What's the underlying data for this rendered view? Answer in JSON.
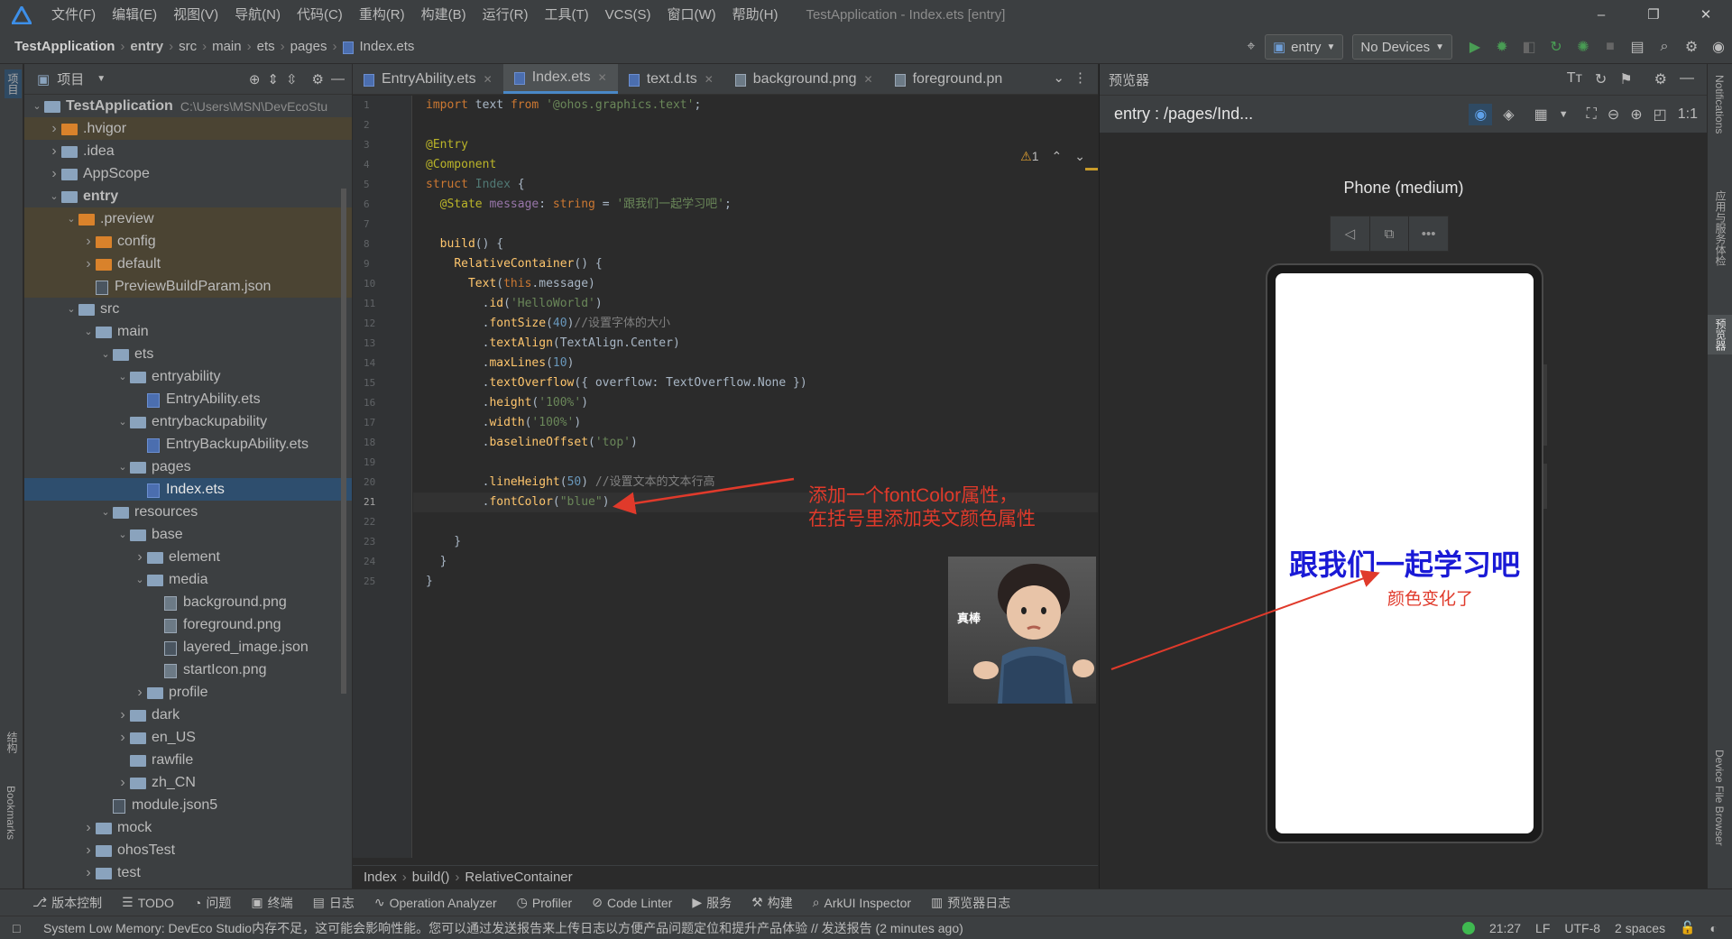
{
  "menubar": {
    "items": [
      "文件(F)",
      "编辑(E)",
      "视图(V)",
      "导航(N)",
      "代码(C)",
      "重构(R)",
      "构建(B)",
      "运行(R)",
      "工具(T)",
      "VCS(S)",
      "窗口(W)",
      "帮助(H)"
    ],
    "window_title": "TestApplication - Index.ets [entry]",
    "min": "–",
    "max": "❐",
    "close": "✕"
  },
  "navbar": {
    "crumbs": [
      "TestApplication",
      "entry",
      "src",
      "main",
      "ets",
      "pages",
      "Index.ets"
    ],
    "module_combo": "entry",
    "device_combo": "No Devices"
  },
  "left_strip": {
    "project": "项目",
    "structure": "结构",
    "bookmarks": "Bookmarks"
  },
  "right_strip": {
    "notifications": "Notifications",
    "services": "应用与服务体检",
    "previewer": "预览器",
    "device_file": "Device File Browser"
  },
  "project": {
    "title": "项目",
    "tree": [
      {
        "label": "TestApplication",
        "extra": "C:\\Users\\MSN\\DevEcoStu",
        "depth": 0,
        "arrow": "open",
        "kind": "module",
        "bold": true
      },
      {
        "label": ".hvigor",
        "depth": 1,
        "arrow": "closed",
        "kind": "folder-orange",
        "hl": true
      },
      {
        "label": ".idea",
        "depth": 1,
        "arrow": "closed",
        "kind": "folder"
      },
      {
        "label": "AppScope",
        "depth": 1,
        "arrow": "closed",
        "kind": "folder"
      },
      {
        "label": "entry",
        "depth": 1,
        "arrow": "open",
        "kind": "module",
        "bold": true
      },
      {
        "label": ".preview",
        "depth": 2,
        "arrow": "open",
        "kind": "folder-orange",
        "hl": true
      },
      {
        "label": "config",
        "depth": 3,
        "arrow": "closed",
        "kind": "folder-orange",
        "hl": true
      },
      {
        "label": "default",
        "depth": 3,
        "arrow": "closed",
        "kind": "folder-orange",
        "hl": true
      },
      {
        "label": "PreviewBuildParam.json",
        "depth": 3,
        "arrow": "none",
        "kind": "file",
        "hl": true
      },
      {
        "label": "src",
        "depth": 2,
        "arrow": "open",
        "kind": "folder"
      },
      {
        "label": "main",
        "depth": 3,
        "arrow": "open",
        "kind": "folder"
      },
      {
        "label": "ets",
        "depth": 4,
        "arrow": "open",
        "kind": "folder"
      },
      {
        "label": "entryability",
        "depth": 5,
        "arrow": "open",
        "kind": "folder"
      },
      {
        "label": "EntryAbility.ets",
        "depth": 6,
        "arrow": "none",
        "kind": "file-ets"
      },
      {
        "label": "entrybackupability",
        "depth": 5,
        "arrow": "open",
        "kind": "folder"
      },
      {
        "label": "EntryBackupAbility.ets",
        "depth": 6,
        "arrow": "none",
        "kind": "file-ets"
      },
      {
        "label": "pages",
        "depth": 5,
        "arrow": "open",
        "kind": "folder"
      },
      {
        "label": "Index.ets",
        "depth": 6,
        "arrow": "none",
        "kind": "file-ets",
        "sel": true
      },
      {
        "label": "resources",
        "depth": 4,
        "arrow": "open",
        "kind": "folder"
      },
      {
        "label": "base",
        "depth": 5,
        "arrow": "open",
        "kind": "folder"
      },
      {
        "label": "element",
        "depth": 6,
        "arrow": "closed",
        "kind": "folder"
      },
      {
        "label": "media",
        "depth": 6,
        "arrow": "open",
        "kind": "folder"
      },
      {
        "label": "background.png",
        "depth": 7,
        "arrow": "none",
        "kind": "file-img"
      },
      {
        "label": "foreground.png",
        "depth": 7,
        "arrow": "none",
        "kind": "file-img"
      },
      {
        "label": "layered_image.json",
        "depth": 7,
        "arrow": "none",
        "kind": "file"
      },
      {
        "label": "startIcon.png",
        "depth": 7,
        "arrow": "none",
        "kind": "file-img"
      },
      {
        "label": "profile",
        "depth": 6,
        "arrow": "closed",
        "kind": "folder"
      },
      {
        "label": "dark",
        "depth": 5,
        "arrow": "closed",
        "kind": "folder"
      },
      {
        "label": "en_US",
        "depth": 5,
        "arrow": "closed",
        "kind": "folder"
      },
      {
        "label": "rawfile",
        "depth": 5,
        "arrow": "none",
        "kind": "folder"
      },
      {
        "label": "zh_CN",
        "depth": 5,
        "arrow": "closed",
        "kind": "folder"
      },
      {
        "label": "module.json5",
        "depth": 4,
        "arrow": "none",
        "kind": "file"
      },
      {
        "label": "mock",
        "depth": 3,
        "arrow": "closed",
        "kind": "folder"
      },
      {
        "label": "ohosTest",
        "depth": 3,
        "arrow": "closed",
        "kind": "folder"
      },
      {
        "label": "test",
        "depth": 3,
        "arrow": "closed",
        "kind": "folder"
      }
    ]
  },
  "editor": {
    "tabs": [
      {
        "label": "EntryAbility.ets",
        "active": false
      },
      {
        "label": "Index.ets",
        "active": true
      },
      {
        "label": "text.d.ts",
        "active": false
      },
      {
        "label": "background.png",
        "active": false
      },
      {
        "label": "foreground.pn",
        "active": false
      }
    ],
    "warning_count": "1",
    "current_line": 21,
    "lines": [
      [
        [
          "kw",
          "import "
        ],
        [
          "",
          "text "
        ],
        [
          "kw",
          "from "
        ],
        [
          "st",
          "'@ohos.graphics.text'"
        ],
        [
          "",
          ";"
        ]
      ],
      [],
      [
        [
          "an",
          "@Entry"
        ]
      ],
      [
        [
          "an",
          "@Component"
        ]
      ],
      [
        [
          "kw",
          "struct "
        ],
        [
          "ty",
          "Index "
        ],
        [
          "",
          "{"
        ]
      ],
      [
        [
          "",
          "  "
        ],
        [
          "an",
          "@State "
        ],
        [
          "pr",
          "message"
        ],
        [
          "",
          ": "
        ],
        [
          "kw",
          "string "
        ],
        [
          "",
          "= "
        ],
        [
          "st",
          "'跟我们一起学习吧'"
        ],
        [
          "",
          ";"
        ]
      ],
      [],
      [
        [
          "",
          "  "
        ],
        [
          "fn",
          "build"
        ],
        [
          "",
          "() {"
        ]
      ],
      [
        [
          "",
          "    "
        ],
        [
          "fn",
          "RelativeContainer"
        ],
        [
          "",
          "() {"
        ]
      ],
      [
        [
          "",
          "      "
        ],
        [
          "fn",
          "Text"
        ],
        [
          "",
          "("
        ],
        [
          "kw",
          "this"
        ],
        [
          "",
          ".message)"
        ]
      ],
      [
        [
          "",
          "        ."
        ],
        [
          "fn",
          "id"
        ],
        [
          "",
          "("
        ],
        [
          "st",
          "'HelloWorld'"
        ],
        [
          "",
          ")"
        ]
      ],
      [
        [
          "",
          "        ."
        ],
        [
          "fn",
          "fontSize"
        ],
        [
          "",
          "("
        ],
        [
          "nu",
          "40"
        ],
        [
          "",
          ")"
        ],
        [
          "cm",
          "//设置字体的大小"
        ]
      ],
      [
        [
          "",
          "        ."
        ],
        [
          "fn",
          "textAlign"
        ],
        [
          "",
          "(TextAlign.Center)"
        ]
      ],
      [
        [
          "",
          "        ."
        ],
        [
          "fn",
          "maxLines"
        ],
        [
          "",
          "("
        ],
        [
          "nu",
          "10"
        ],
        [
          "",
          ")"
        ]
      ],
      [
        [
          "",
          "        ."
        ],
        [
          "fn",
          "textOverflow"
        ],
        [
          "",
          "({ overflow: TextOverflow.None })"
        ]
      ],
      [
        [
          "",
          "        ."
        ],
        [
          "fn",
          "height"
        ],
        [
          "",
          "("
        ],
        [
          "st",
          "'100%'"
        ],
        [
          "",
          ")"
        ]
      ],
      [
        [
          "",
          "        ."
        ],
        [
          "fn",
          "width"
        ],
        [
          "",
          "("
        ],
        [
          "st",
          "'100%'"
        ],
        [
          "",
          ")"
        ]
      ],
      [
        [
          "",
          "        ."
        ],
        [
          "fn",
          "baselineOffset"
        ],
        [
          "",
          "("
        ],
        [
          "st",
          "'top'"
        ],
        [
          "",
          ")"
        ]
      ],
      [],
      [
        [
          "",
          "        ."
        ],
        [
          "fn",
          "lineHeight"
        ],
        [
          "",
          "("
        ],
        [
          "nu",
          "50"
        ],
        [
          "",
          ") "
        ],
        [
          "cm",
          "//设置文本的文本行高"
        ]
      ],
      [
        [
          "",
          "        ."
        ],
        [
          "fn",
          "fontColor"
        ],
        [
          "",
          "("
        ],
        [
          "st",
          "\"blue\""
        ],
        [
          "",
          ")"
        ]
      ],
      [],
      [
        [
          "",
          "    }"
        ]
      ],
      [
        [
          "",
          "  }"
        ]
      ],
      [
        [
          "",
          "}"
        ]
      ]
    ],
    "breadcrumb": [
      "Index",
      "build()",
      "RelativeContainer"
    ]
  },
  "annotations": {
    "code_note_line1": "添加一个fontColor属性，",
    "code_note_line2": "在括号里添加英文颜色属性",
    "sticker_text": "真棒",
    "phone_note": "颜色变化了"
  },
  "previewer": {
    "title": "预览器",
    "route": "entry : /pages/Ind...",
    "device_name": "Phone (medium)",
    "phone_text": "跟我们一起学习吧",
    "phone_text_color": "#1a1ad6",
    "ratio": "1:1"
  },
  "bottom_tools": [
    "版本控制",
    "TODO",
    "问题",
    "终端",
    "日志",
    "Operation Analyzer",
    "Profiler",
    "Code Linter",
    "服务",
    "构建",
    "ArkUI Inspector",
    "预览器日志"
  ],
  "status": {
    "message": "System Low Memory: DevEco Studio内存不足，这可能会影响性能。您可以通过发送报告来上传日志以方便产品问题定位和提升产品体验 // 发送报告 (2 minutes ago)",
    "position": "21:27",
    "line_sep": "LF",
    "encoding": "UTF-8",
    "indent": "2 spaces"
  }
}
